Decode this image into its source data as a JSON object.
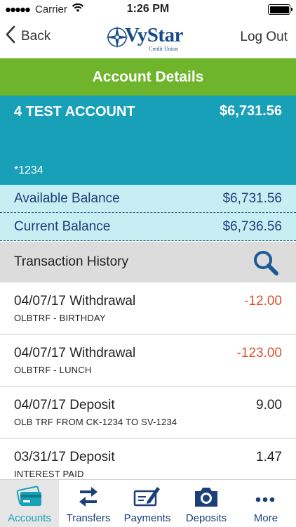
{
  "status_bar": {
    "carrier": "Carrier",
    "time": "1:26 PM"
  },
  "nav": {
    "back_label": "Back",
    "logout_label": "Log Out",
    "logo_text": "VyStar",
    "logo_subtext": "Credit Union"
  },
  "title": "Account Details",
  "account": {
    "name": "4 TEST ACCOUNT",
    "balance": "$6,731.56",
    "number": "*1234"
  },
  "balances": {
    "available_label": "Available Balance",
    "available_value": "$6,731.56",
    "current_label": "Current Balance",
    "current_value": "$6,736.56"
  },
  "history": {
    "label": "Transaction History",
    "transactions": [
      {
        "title": "04/07/17 Withdrawal",
        "memo": "OLBTRF - BIRTHDAY",
        "amount": "-12.00"
      },
      {
        "title": "04/07/17 Withdrawal",
        "memo": "OLBTRF - LUNCH",
        "amount": "-123.00"
      },
      {
        "title": "04/07/17 Deposit",
        "memo": "OLB TRF FROM CK-1234 TO SV-1234",
        "amount": "9.00"
      },
      {
        "title": "03/31/17 Deposit",
        "memo": "INTEREST PAID",
        "amount": "1.47"
      }
    ]
  },
  "tabs": [
    {
      "label": "Accounts",
      "icon": "accounts-card-icon",
      "active": true
    },
    {
      "label": "Transfers",
      "icon": "transfer-arrows-icon",
      "active": false
    },
    {
      "label": "Payments",
      "icon": "check-pen-icon",
      "active": false
    },
    {
      "label": "Deposits",
      "icon": "camera-icon",
      "active": false
    },
    {
      "label": "More",
      "icon": "more-dots-icon",
      "active": false
    }
  ],
  "colors": {
    "header_green": "#6fb52c",
    "account_teal": "#17a0b8",
    "balance_bg": "#c7eef3",
    "navy": "#1b3f78",
    "negative_red": "#d9532c"
  }
}
